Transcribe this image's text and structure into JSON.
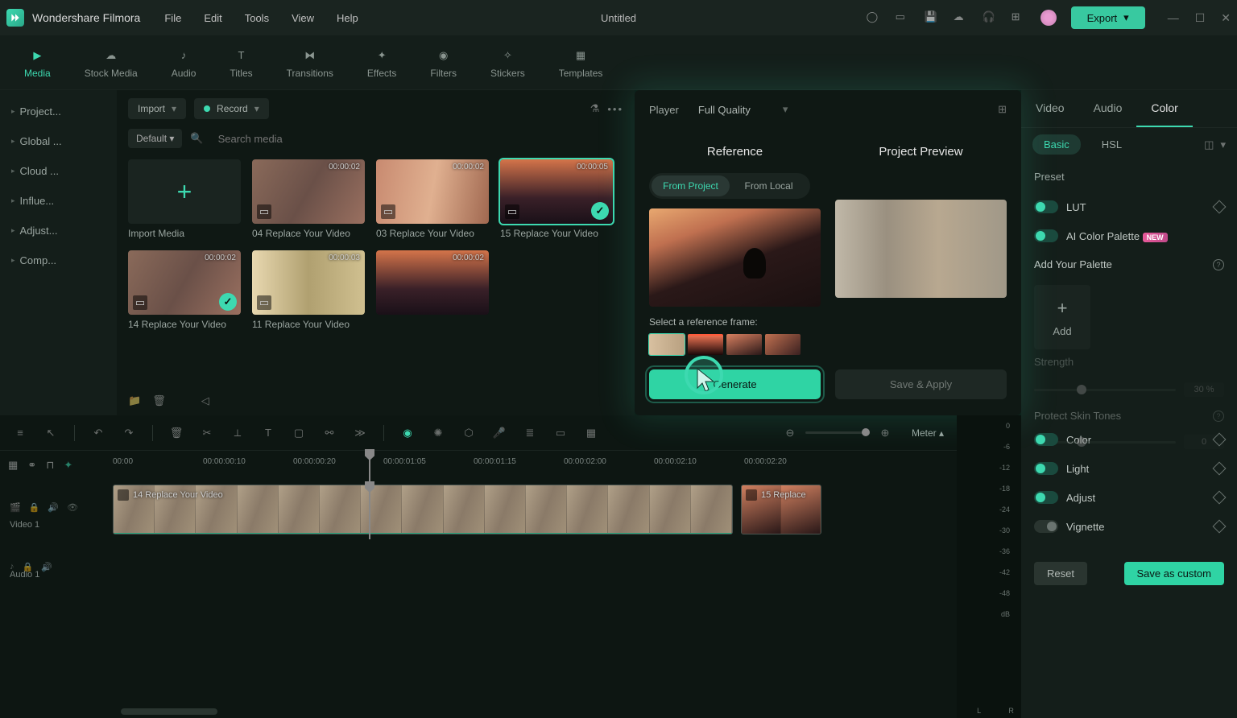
{
  "app": {
    "name": "Wondershare Filmora",
    "document": "Untitled"
  },
  "menu": [
    "File",
    "Edit",
    "Tools",
    "View",
    "Help"
  ],
  "export": "Export",
  "tabs": [
    {
      "label": "Media",
      "active": true
    },
    {
      "label": "Stock Media"
    },
    {
      "label": "Audio"
    },
    {
      "label": "Titles"
    },
    {
      "label": "Transitions"
    },
    {
      "label": "Effects"
    },
    {
      "label": "Filters"
    },
    {
      "label": "Stickers"
    },
    {
      "label": "Templates"
    }
  ],
  "sidebar": [
    "Project...",
    "Global ...",
    "Cloud ...",
    "Influe...",
    "Adjust...",
    "Comp..."
  ],
  "media_toolbar": {
    "import": "Import",
    "record": "Record",
    "default": "Default ▾",
    "search_ph": "Search media"
  },
  "media": [
    {
      "label": "Import Media",
      "add": true
    },
    {
      "label": "04 Replace Your Video",
      "dur": "00:00:02"
    },
    {
      "label": "03 Replace Your Video",
      "dur": "00:00:02"
    },
    {
      "label": "15 Replace Your Video",
      "dur": "00:00:05",
      "selected": true,
      "checked": true,
      "cls": "sunset"
    },
    {
      "label": "14 Replace Your Video",
      "dur": "00:00:02",
      "checked": true
    },
    {
      "label": "11 Replace Your Video",
      "dur": "00:00:03",
      "cls": "picnic"
    },
    {
      "label": "",
      "dur": "00:00:02",
      "cls": "sunset"
    }
  ],
  "player": {
    "label": "Player",
    "quality": "Full Quality",
    "ref_title": "Reference",
    "proj_title": "Project Preview",
    "src_tabs": [
      "From Project",
      "From Local"
    ],
    "ref_frame_label": "Select a reference frame:",
    "generate": "Generate",
    "save_apply": "Save & Apply"
  },
  "right": {
    "tabs": [
      "Video",
      "Audio",
      "Color"
    ],
    "sub": [
      "Basic",
      "HSL"
    ],
    "preset": "Preset",
    "lut": "LUT",
    "ai_palette": "AI Color Palette",
    "new": "NEW",
    "add_palette": "Add Your Palette",
    "add": "Add",
    "strength": "Strength",
    "strength_val": "30",
    "pct": "%",
    "protect": "Protect Skin Tones",
    "protect_val": "0",
    "sections": [
      "Color",
      "Light",
      "Adjust",
      "Vignette"
    ],
    "reset": "Reset",
    "save_custom": "Save as custom"
  },
  "timeline": {
    "meter": "Meter ▴",
    "ticks": [
      "00:00",
      "00:00:00:10",
      "00:00:00:20",
      "00:00:01:05",
      "00:00:01:15",
      "00:00:02:00",
      "00:00:02:10",
      "00:00:02:20"
    ],
    "track_video": "Video 1",
    "track_audio": "Audio 1",
    "clip1": "14 Replace Your Video",
    "clip2": "15 Replace",
    "db": [
      "0",
      "-6",
      "-12",
      "-18",
      "-24",
      "-30",
      "-36",
      "-42",
      "-48",
      "dB"
    ],
    "lr": [
      "L",
      "R"
    ]
  }
}
